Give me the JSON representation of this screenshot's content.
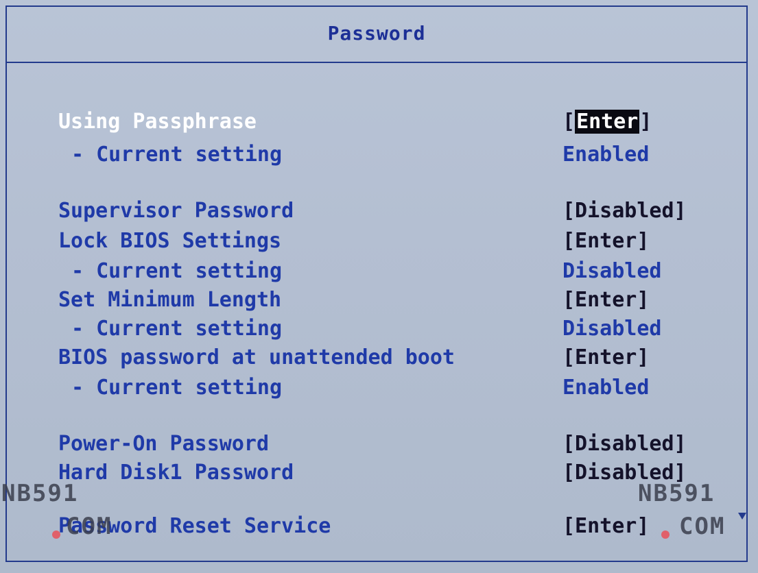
{
  "window": {
    "title": "Password"
  },
  "items": [
    {
      "label": "Using Passphrase",
      "value_prefix": "[",
      "value": "Enter",
      "value_suffix": "]"
    },
    {
      "label": "- Current setting",
      "value": "Enabled"
    },
    {
      "label": "Supervisor Password",
      "value": "[Disabled]"
    },
    {
      "label": "Lock BIOS Settings",
      "value": "[Enter]"
    },
    {
      "label": "- Current setting",
      "value": "Disabled"
    },
    {
      "label": "Set Minimum Length",
      "value": "[Enter]"
    },
    {
      "label": "- Current setting",
      "value": "Disabled"
    },
    {
      "label": "BIOS password at unattended boot",
      "value": "[Enter]"
    },
    {
      "label": "- Current setting",
      "value": "Enabled"
    },
    {
      "label": "Power-On Password",
      "value": "[Disabled]"
    },
    {
      "label": "Hard Disk1 Password",
      "value": "[Disabled]"
    },
    {
      "label": "Password Reset Service",
      "value": "[Enter]"
    }
  ],
  "watermark": {
    "line1": "NB591",
    "line2": "COM"
  },
  "colors": {
    "label": "#1f3aa8",
    "selected_label": "#ffffff",
    "highlight_bg": "#0a0a12",
    "border": "#233a8c"
  }
}
